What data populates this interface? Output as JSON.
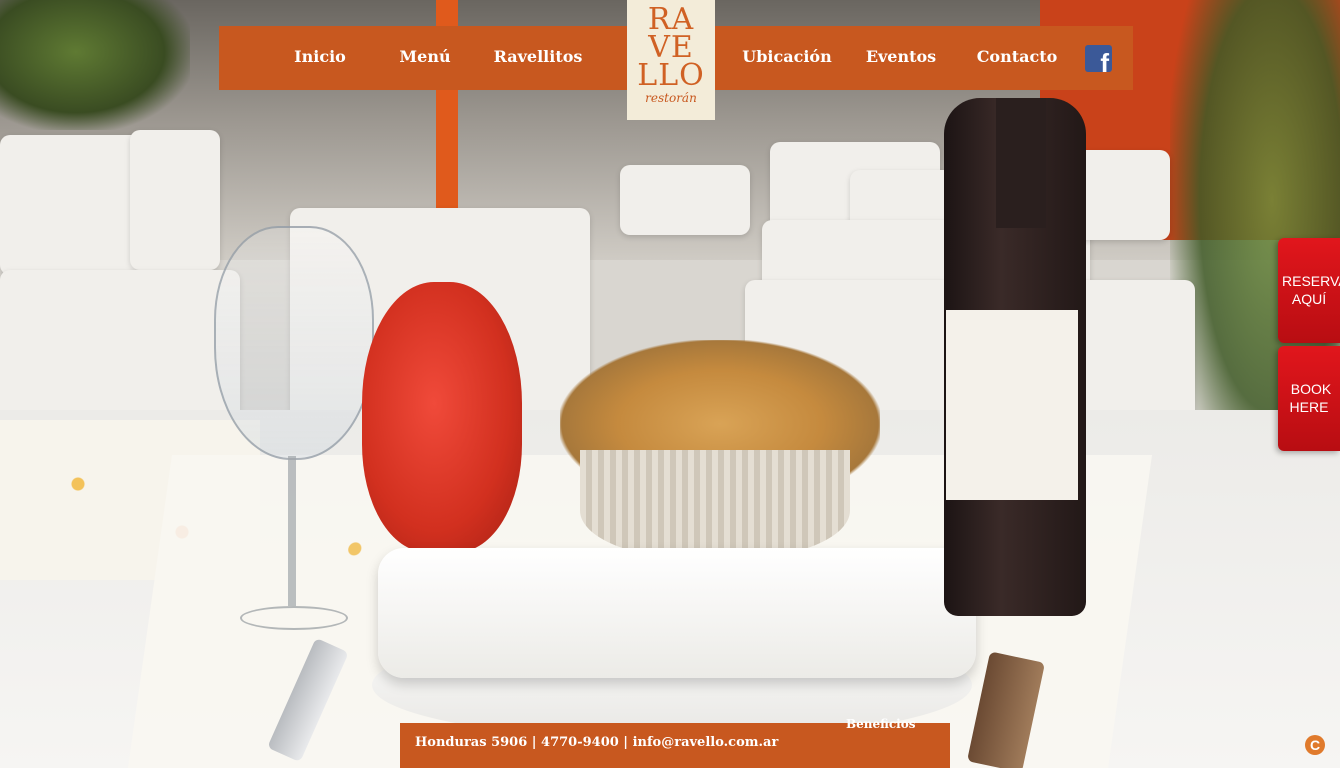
{
  "nav": {
    "items": [
      {
        "label": "Inicio"
      },
      {
        "label": "Menú"
      },
      {
        "label": "Ravellitos"
      },
      {
        "label": "Ubicación"
      },
      {
        "label": "Eventos"
      },
      {
        "label": "Contacto"
      }
    ],
    "facebook_icon": "facebook-icon"
  },
  "logo": {
    "line1": "RA",
    "line2": "VE",
    "line3": "LLO",
    "subtitle": "restorán"
  },
  "reserve": {
    "es_line1": "RESERVA",
    "es_line2": "AQUÍ",
    "en_line1": "BOOK",
    "en_line2": "HERE"
  },
  "footer": {
    "contact": "Honduras 5906 | 4770-9400 | info@ravello.com.ar",
    "beneficios": "Beneficios"
  },
  "corner_badge": "C",
  "colors": {
    "brand_orange": "#c8581f",
    "reserve_red": "#e1161c",
    "facebook_blue": "#3b5998"
  }
}
